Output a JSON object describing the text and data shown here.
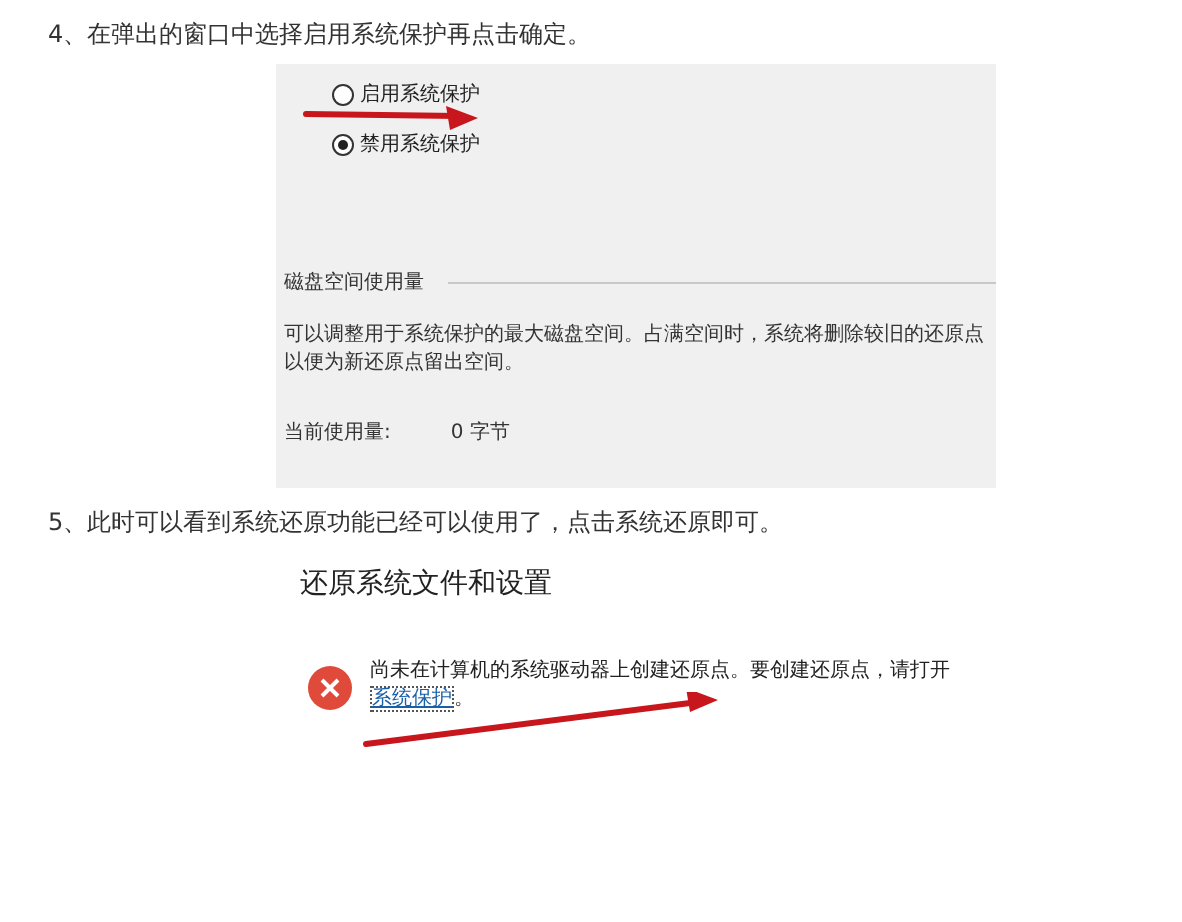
{
  "steps": [
    {
      "kind": "dialog",
      "text": "4、在弹出的窗口中选择启用系统保护再点击确定。",
      "options": [
        {
          "label": "启用系统保护",
          "selected": false
        },
        {
          "label": "禁用系统保护",
          "selected": true
        }
      ],
      "section_title": "磁盘空间使用量",
      "description": "可以调整用于系统保护的最大磁盘空间。占满空间时，系统将删除较旧的还原点以便为新还原点留出空间。",
      "usage_label": "当前使用量:",
      "usage_value": "0 字节"
    },
    {
      "kind": "restore",
      "text": "5、此时可以看到系统还原功能已经可以使用了，点击系统还原即可。",
      "title": "还原系统文件和设置",
      "message": "尚未在计算机的系统驱动器上创建还原点。要创建还原点，请打开",
      "link": "系统保护",
      "message_end": "。"
    }
  ]
}
